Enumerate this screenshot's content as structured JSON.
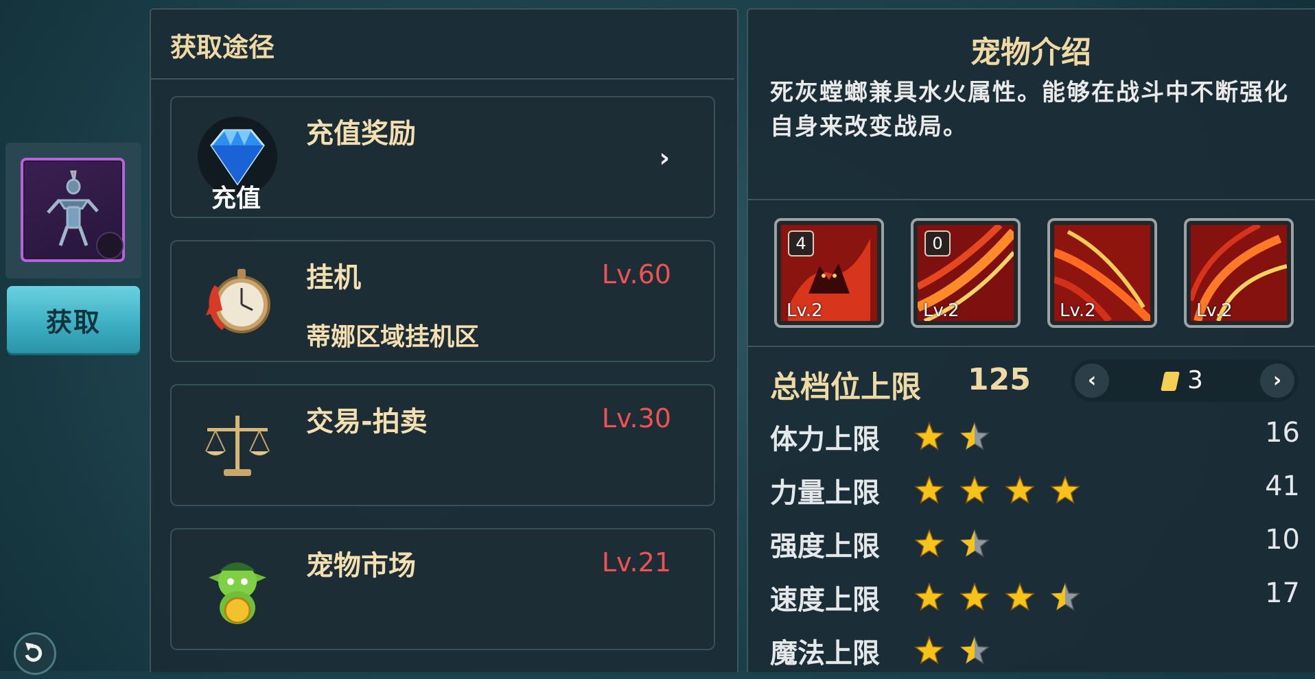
{
  "left_panel": {
    "title": "获取途径",
    "routes": [
      {
        "name": "充值奖励",
        "sub": "",
        "level": "",
        "icon": "diamond-icon",
        "icon_label": "充值"
      },
      {
        "name": "挂机",
        "sub": "蒂娜区域挂机区",
        "level": "Lv.60",
        "icon": "stopwatch-icon"
      },
      {
        "name": "交易-拍卖",
        "sub": "",
        "level": "Lv.30",
        "icon": "scales-icon"
      },
      {
        "name": "宠物市场",
        "sub": "",
        "level": "Lv.21",
        "icon": "goblin-coin-icon"
      }
    ]
  },
  "item": {
    "acquire_label": "获取",
    "frame_color": "#b463d8"
  },
  "right_panel": {
    "title": "宠物介绍",
    "description": "死灰螳螂兼具水火属性。能够在战斗中不断强化自身来改变战局。",
    "skills": [
      {
        "level": "Lv.2",
        "badge": "4",
        "icon": "fire-demon-skill-icon"
      },
      {
        "level": "Lv.2",
        "badge": "0",
        "icon": "fire-slash-skill-icon"
      },
      {
        "level": "Lv.2",
        "badge": "",
        "icon": "flame-claw-skill-icon"
      },
      {
        "level": "Lv.2",
        "badge": "",
        "icon": "flame-wave-skill-icon"
      }
    ],
    "tier": {
      "label": "总档位上限",
      "value": "125",
      "page": "3"
    },
    "stats": [
      {
        "label": "体力上限",
        "stars": 1.5,
        "value": "16"
      },
      {
        "label": "力量上限",
        "stars": 4,
        "value": "41"
      },
      {
        "label": "强度上限",
        "stars": 1.5,
        "value": "10"
      },
      {
        "label": "速度上限",
        "stars": 3.5,
        "value": "17"
      },
      {
        "label": "魔法上限",
        "stars": 1.5,
        "value": ""
      }
    ]
  },
  "colors": {
    "gold_text": "#efd9a4",
    "level_red": "#ef5252",
    "star_gold": "#f6c21c",
    "star_grey": "#8f9aa0"
  }
}
